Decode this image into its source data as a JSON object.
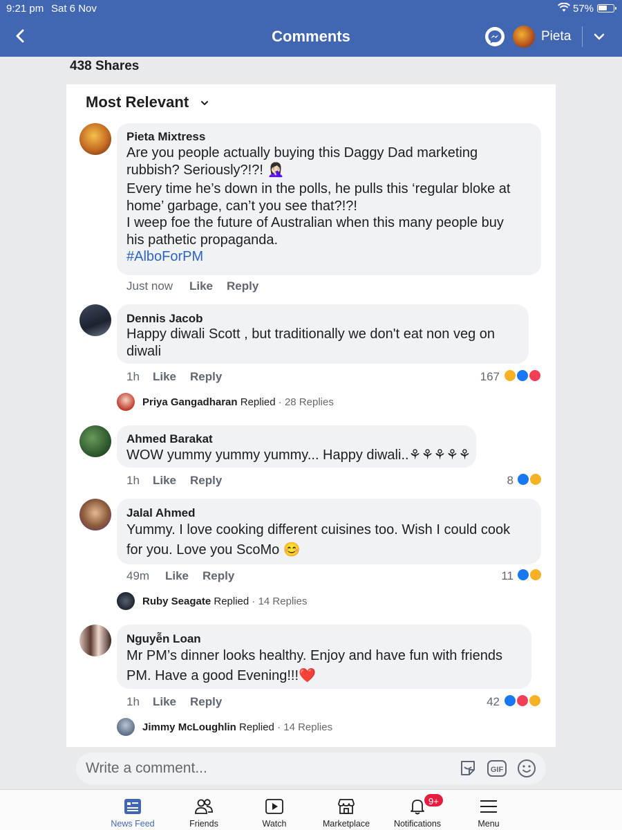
{
  "status_bar": {
    "time": "9:21 pm",
    "date": "Sat 6 Nov",
    "battery": "57%"
  },
  "header": {
    "title": "Comments",
    "user_name": "Pieta"
  },
  "post": {
    "shares": "438 Shares"
  },
  "sort": {
    "label": "Most Relevant"
  },
  "comments": [
    {
      "author": "Pieta Mixtress",
      "lines": [
        "Are you people actually buying this Daggy Dad marketing",
        "rubbish? Seriously?!?! 🤦🏻‍♀️",
        "Every time he’s down in the polls, he pulls this ‘regular bloke at",
        "home’ garbage, can’t you see that?!?!",
        "I weep foe the future of Australian when this many people buy",
        "his pathetic propaganda."
      ],
      "hashtag": "#AlboForPM",
      "time": "Just now",
      "like": "Like",
      "reply": "Reply"
    },
    {
      "author": "Dennis Jacob",
      "lines": [
        "Happy diwali Scott , but traditionally we don't eat non veg on",
        "diwali"
      ],
      "time": "1h",
      "like": "Like",
      "reply": "Reply",
      "reactions": "167",
      "replied": {
        "name": "Priya Gangadharan",
        "label": "Replied",
        "count": "· 28 Replies"
      }
    },
    {
      "author": "Ahmed Barakat",
      "lines": [
        "WOW yummy yummy yummy... Happy diwali..⚘⚘⚘⚘⚘"
      ],
      "time": "1h",
      "like": "Like",
      "reply": "Reply",
      "reactions": "8"
    },
    {
      "author": "Jalal Ahmed",
      "lines": [
        "Yummy. I love cooking different cuisines too. Wish I could cook",
        "for you. Love you ScoMo 😊"
      ],
      "time": "49m",
      "like": "Like",
      "reply": "Reply",
      "reactions": "11",
      "replied": {
        "name": "Ruby Seagate",
        "label": "Replied",
        "count": "· 14 Replies"
      }
    },
    {
      "author": "Nguyễn Loan",
      "lines": [
        "Mr PM’s dinner looks healthy. Enjoy and have fun with friends",
        "PM. Have a good Evening!!!❤️"
      ],
      "time": "1h",
      "like": "Like",
      "reply": "Reply",
      "reactions": "42",
      "replied": {
        "name": "Jimmy McLoughlin",
        "label": "Replied",
        "count": "· 14 Replies"
      }
    }
  ],
  "composer": {
    "placeholder": "Write a comment..."
  },
  "tabs": [
    {
      "label": "News Feed",
      "icon": "news-feed-icon"
    },
    {
      "label": "Friends",
      "icon": "friends-icon"
    },
    {
      "label": "Watch",
      "icon": "watch-icon"
    },
    {
      "label": "Marketplace",
      "icon": "marketplace-icon"
    },
    {
      "label": "Notifications",
      "icon": "bell-icon",
      "badge": "9+"
    },
    {
      "label": "Menu",
      "icon": "menu-icon"
    }
  ],
  "colors": {
    "brand": "#4267b2",
    "link": "#2d63c5",
    "like": "#1877f2",
    "haha": "#f7b125",
    "love": "#f33e58",
    "badge": "#e41e3f"
  }
}
